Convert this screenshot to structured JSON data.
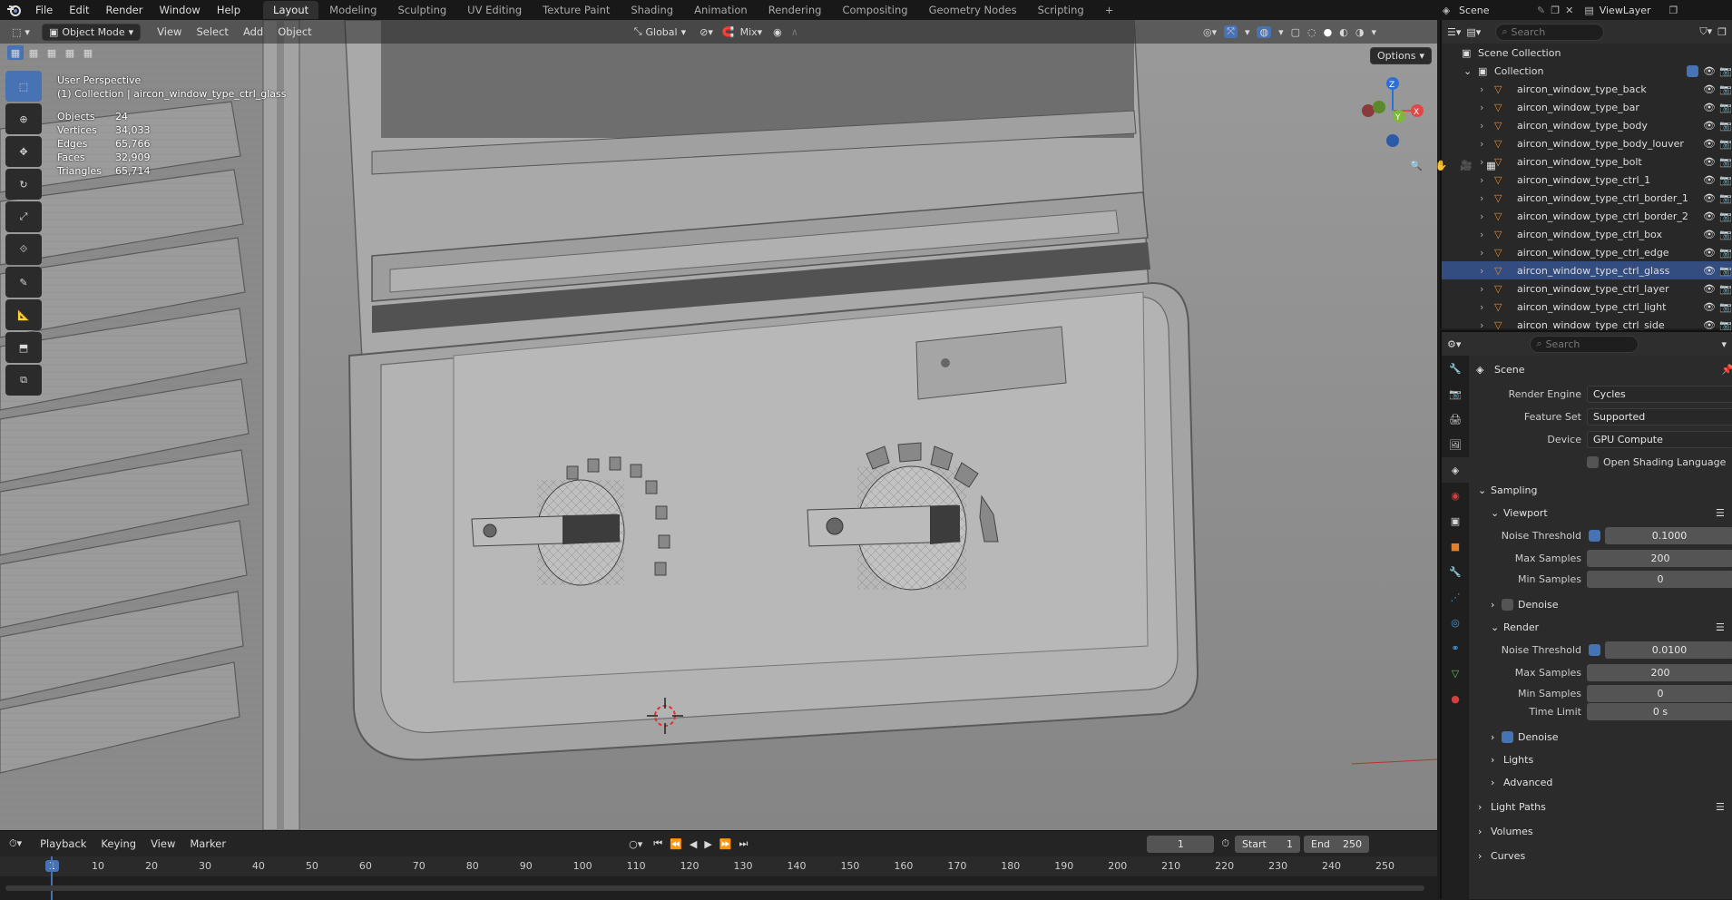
{
  "topbar": {
    "menus": [
      "File",
      "Edit",
      "Render",
      "Window",
      "Help"
    ],
    "workspaces": [
      "Layout",
      "Modeling",
      "Sculpting",
      "UV Editing",
      "Texture Paint",
      "Shading",
      "Animation",
      "Rendering",
      "Compositing",
      "Geometry Nodes",
      "Scripting"
    ],
    "active_workspace": "Layout",
    "scene_label": "Scene",
    "viewlayer_label": "ViewLayer"
  },
  "viewport_header": {
    "mode": "Object Mode",
    "menus": [
      "View",
      "Select",
      "Add",
      "Object"
    ],
    "orientation": "Global",
    "snap_mode": "Mix",
    "options_label": "Options"
  },
  "overlay": {
    "perspective": "User Perspective",
    "active_object": "(1) Collection | aircon_window_type_ctrl_glass",
    "stats": [
      {
        "label": "Objects",
        "value": "24"
      },
      {
        "label": "Vertices",
        "value": "34,033"
      },
      {
        "label": "Edges",
        "value": "65,766"
      },
      {
        "label": "Faces",
        "value": "32,909"
      },
      {
        "label": "Triangles",
        "value": "65,714"
      }
    ]
  },
  "gizmo": {
    "x_label": "X",
    "y_label": "Y",
    "z_label": "Z"
  },
  "timeline": {
    "menus": [
      "Playback",
      "Keying",
      "View",
      "Marker"
    ],
    "current_frame": "1",
    "start_label": "Start",
    "start": "1",
    "end_label": "End",
    "end": "250",
    "ticks": [
      "1",
      "10",
      "20",
      "30",
      "40",
      "50",
      "60",
      "70",
      "80",
      "90",
      "100",
      "110",
      "120",
      "130",
      "140",
      "150",
      "160",
      "170",
      "180",
      "190",
      "200",
      "210",
      "220",
      "230",
      "240",
      "250"
    ]
  },
  "outliner": {
    "search_placeholder": "Search",
    "scene_collection": "Scene Collection",
    "collection": "Collection",
    "items": [
      {
        "name": "aircon_window_type_back",
        "selected": false
      },
      {
        "name": "aircon_window_type_bar",
        "selected": false
      },
      {
        "name": "aircon_window_type_body",
        "selected": false
      },
      {
        "name": "aircon_window_type_body_louver",
        "selected": false
      },
      {
        "name": "aircon_window_type_bolt",
        "selected": false
      },
      {
        "name": "aircon_window_type_ctrl_1",
        "selected": false
      },
      {
        "name": "aircon_window_type_ctrl_border_1",
        "selected": false
      },
      {
        "name": "aircon_window_type_ctrl_border_2",
        "selected": false
      },
      {
        "name": "aircon_window_type_ctrl_box",
        "selected": false
      },
      {
        "name": "aircon_window_type_ctrl_edge",
        "selected": false
      },
      {
        "name": "aircon_window_type_ctrl_glass",
        "selected": true
      },
      {
        "name": "aircon_window_type_ctrl_layer",
        "selected": false
      },
      {
        "name": "aircon_window_type_ctrl_light",
        "selected": false
      },
      {
        "name": "aircon_window_type_ctrl_side",
        "selected": false
      }
    ]
  },
  "properties": {
    "search_placeholder": "Search",
    "context": "Scene",
    "render_engine_label": "Render Engine",
    "render_engine": "Cycles",
    "feature_set_label": "Feature Set",
    "feature_set": "Supported",
    "device_label": "Device",
    "device": "GPU Compute",
    "osl_label": "Open Shading Language",
    "sampling_label": "Sampling",
    "viewport_label": "Viewport",
    "noise_threshold_label": "Noise Threshold",
    "viewport_noise_threshold": "0.1000",
    "max_samples_label": "Max Samples",
    "viewport_max_samples": "200",
    "min_samples_label": "Min Samples",
    "viewport_min_samples": "0",
    "denoise_label": "Denoise",
    "render_label": "Render",
    "render_noise_threshold": "0.0100",
    "render_max_samples": "200",
    "render_min_samples": "0",
    "time_limit_label": "Time Limit",
    "time_limit": "0 s",
    "lights_label": "Lights",
    "advanced_label": "Advanced",
    "light_paths_label": "Light Paths",
    "volumes_label": "Volumes",
    "curves_label": "Curves"
  },
  "colors": {
    "accent": "#4772b3",
    "selection": "#334d80",
    "panel": "#2b2b2b",
    "viewport": "#8c8c8c"
  }
}
